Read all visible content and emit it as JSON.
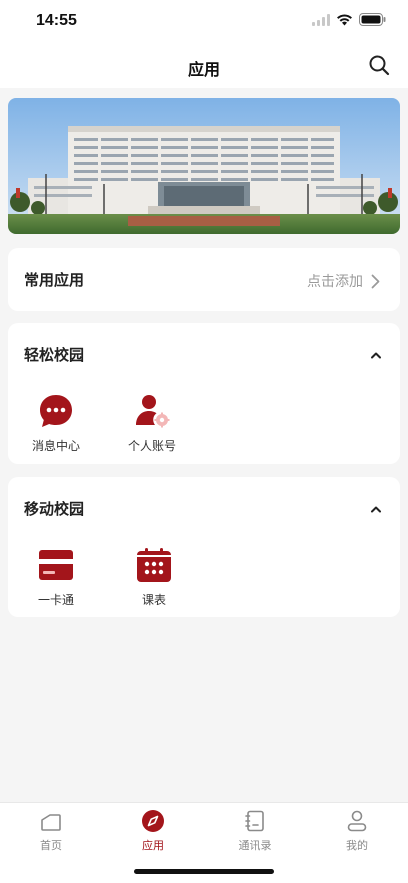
{
  "status_bar": {
    "time": "14:55"
  },
  "header": {
    "title": "应用",
    "search_icon": "search-icon"
  },
  "colors": {
    "brand": "#a3151b",
    "background": "#f5f5f5",
    "muted": "#9a9a9a"
  },
  "banner": {
    "image": "campus-building-photo"
  },
  "frequent_apps": {
    "title": "常用应用",
    "action_label": "点击添加"
  },
  "easy_campus": {
    "title": "轻松校园",
    "items": [
      {
        "label": "消息中心",
        "icon": "chat-bubble-icon"
      },
      {
        "label": "个人账号",
        "icon": "user-settings-icon"
      }
    ]
  },
  "mobile_campus": {
    "title": "移动校园",
    "items": [
      {
        "label": "一卡通",
        "icon": "card-icon"
      },
      {
        "label": "课表",
        "icon": "calendar-icon"
      }
    ]
  },
  "tab_bar": {
    "tabs": [
      {
        "label": "首页",
        "icon": "home-icon",
        "active": false
      },
      {
        "label": "应用",
        "icon": "compass-icon",
        "active": true
      },
      {
        "label": "通讯录",
        "icon": "contacts-book-icon",
        "active": false
      },
      {
        "label": "我的",
        "icon": "person-icon",
        "active": false
      }
    ]
  }
}
